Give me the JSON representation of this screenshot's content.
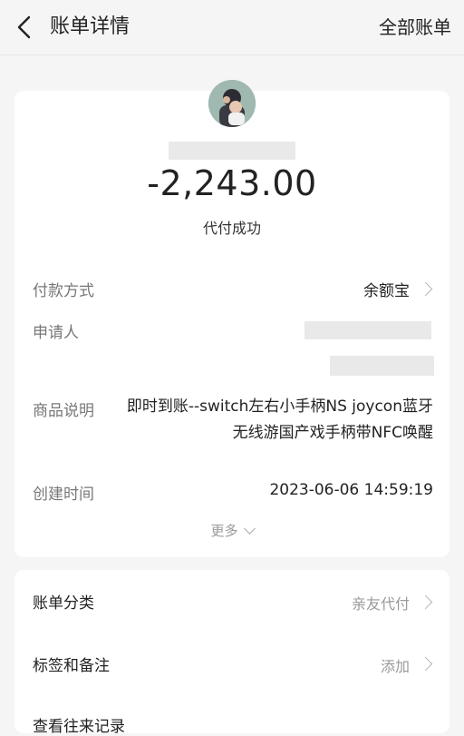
{
  "header": {
    "title": "账单详情",
    "right_action": "全部账单"
  },
  "summary": {
    "amount": "-2,243.00",
    "status": "代付成功"
  },
  "details": {
    "payment_method": {
      "label": "付款方式",
      "value": "余额宝"
    },
    "applicant": {
      "label": "申请人"
    },
    "product": {
      "label": "商品说明",
      "value": "即时到账--switch左右小手柄NS joycon蓝牙无线游国产戏手柄带NFC唤醒"
    },
    "created": {
      "label": "创建时间",
      "value": "2023-06-06 14:59:19"
    },
    "more": "更多"
  },
  "extra": {
    "category": {
      "label": "账单分类",
      "value": "亲友代付"
    },
    "tags": {
      "label": "标签和备注",
      "value": "添加"
    },
    "next_row": {
      "label": "查看往来记录"
    }
  },
  "colors": {
    "background": "#f5f5f5",
    "card": "#ffffff",
    "muted": "#999999"
  }
}
